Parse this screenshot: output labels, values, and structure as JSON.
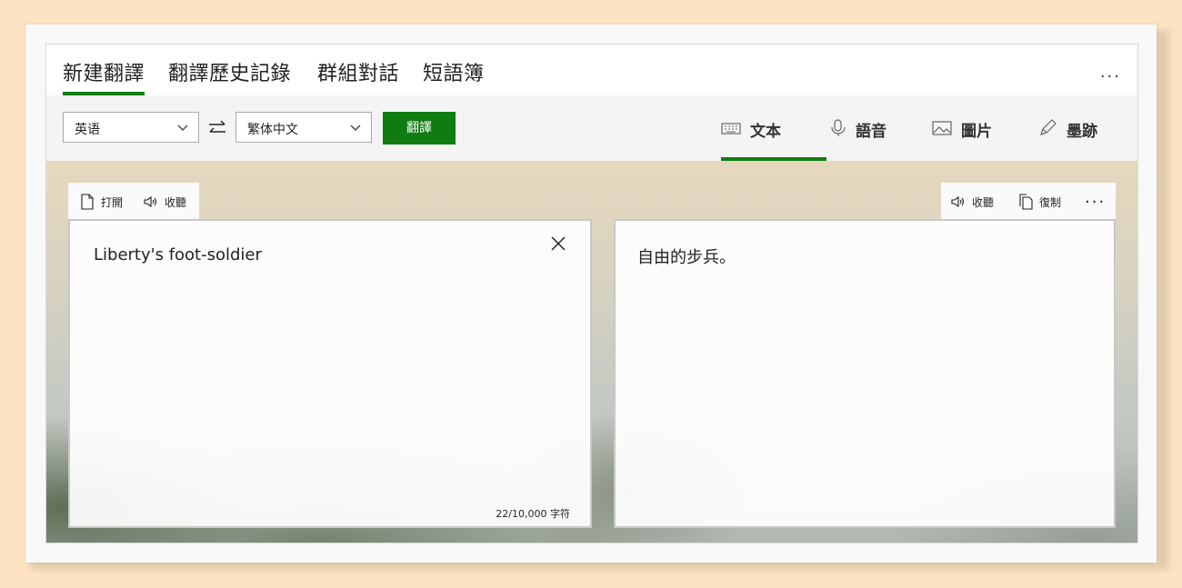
{
  "tabs": [
    {
      "label": "新建翻譯",
      "active": true
    },
    {
      "label": "翻譯歷史記錄",
      "active": false
    },
    {
      "label": "群組對話",
      "active": false
    },
    {
      "label": "短語簿",
      "active": false
    }
  ],
  "more_menu": "...",
  "toolbar": {
    "source_language": "英语",
    "target_language": "繁体中文",
    "translate_label": "翻譯"
  },
  "modes": [
    {
      "label": "文本",
      "icon": "keyboard-icon",
      "active": true
    },
    {
      "label": "語音",
      "icon": "microphone-icon",
      "active": false
    },
    {
      "label": "圖片",
      "icon": "image-icon",
      "active": false
    },
    {
      "label": "墨跡",
      "icon": "pen-icon",
      "active": false
    }
  ],
  "source_panel": {
    "open_label": "打開",
    "listen_label": "收聽",
    "text": "Liberty's foot-soldier",
    "char_count": "22/10,000 字符"
  },
  "target_panel": {
    "listen_label": "收聽",
    "copy_label": "復制",
    "more": "...",
    "text": "自由的步兵。"
  },
  "colors": {
    "accent": "#107c10",
    "background": "#fde3c3"
  }
}
